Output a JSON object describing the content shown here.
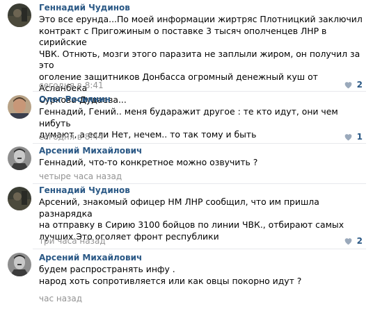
{
  "comments": [
    {
      "author": "Геннадий Чудинов",
      "text": "Это все ерунда...По моей информации жиртряс Плотницкий заключил\nконтракт с Пригожиным о поставке 3 тысяч ополченцев ЛНР в сирийские\nЧВК. Отнють, мозги этого паразита не заплыли жиром, он получил за это\nоголение защитников Донбасса огромный денежный куш от Асланбека\nСуркова-Дудаева...",
      "time": "сегодня в 8:41",
      "likes": "2",
      "avatar": "photo-dark-outdoor"
    },
    {
      "author": "Олег Росиянин",
      "text": "Геннадий, Гений.. меня бударажит другое : те кто идут, они чем нибуть\nдумают, а если Нет, нечем.. то так тому и быть",
      "time": "сегодня в 8:44",
      "likes": "1",
      "avatar": "photo-man-portrait"
    },
    {
      "author": "Арсений Михайлович",
      "text": "Геннадий, что-то конкретное можно озвучить ?",
      "time": "четыре часа назад",
      "likes": "",
      "avatar": "photo-bw-uniform-portrait"
    },
    {
      "author": "Геннадий Чудинов",
      "text": "Арсений, знакомый офицер НМ ЛНР сообщил, что им пришла разнарядка\nна отправку в Сирию 3100 бойцов по линии ЧВК., отбирают самых\nлучших.Это оголяет фронт республики",
      "time": "три часа назад",
      "likes": "2",
      "avatar": "photo-dark-outdoor"
    },
    {
      "author": "Арсений Михайлович",
      "text": "будем распространять инфу .\nнарод хоть сопротивляется или как овцы покорно идут ?",
      "time": "час назад",
      "likes": "",
      "avatar": "photo-bw-uniform-portrait"
    }
  ],
  "icons": {
    "like": "heart-icon"
  },
  "colors": {
    "author": "#2a5885",
    "meta": "#939393",
    "like": "#9aa9bb",
    "divider": "#e7e8ec"
  }
}
